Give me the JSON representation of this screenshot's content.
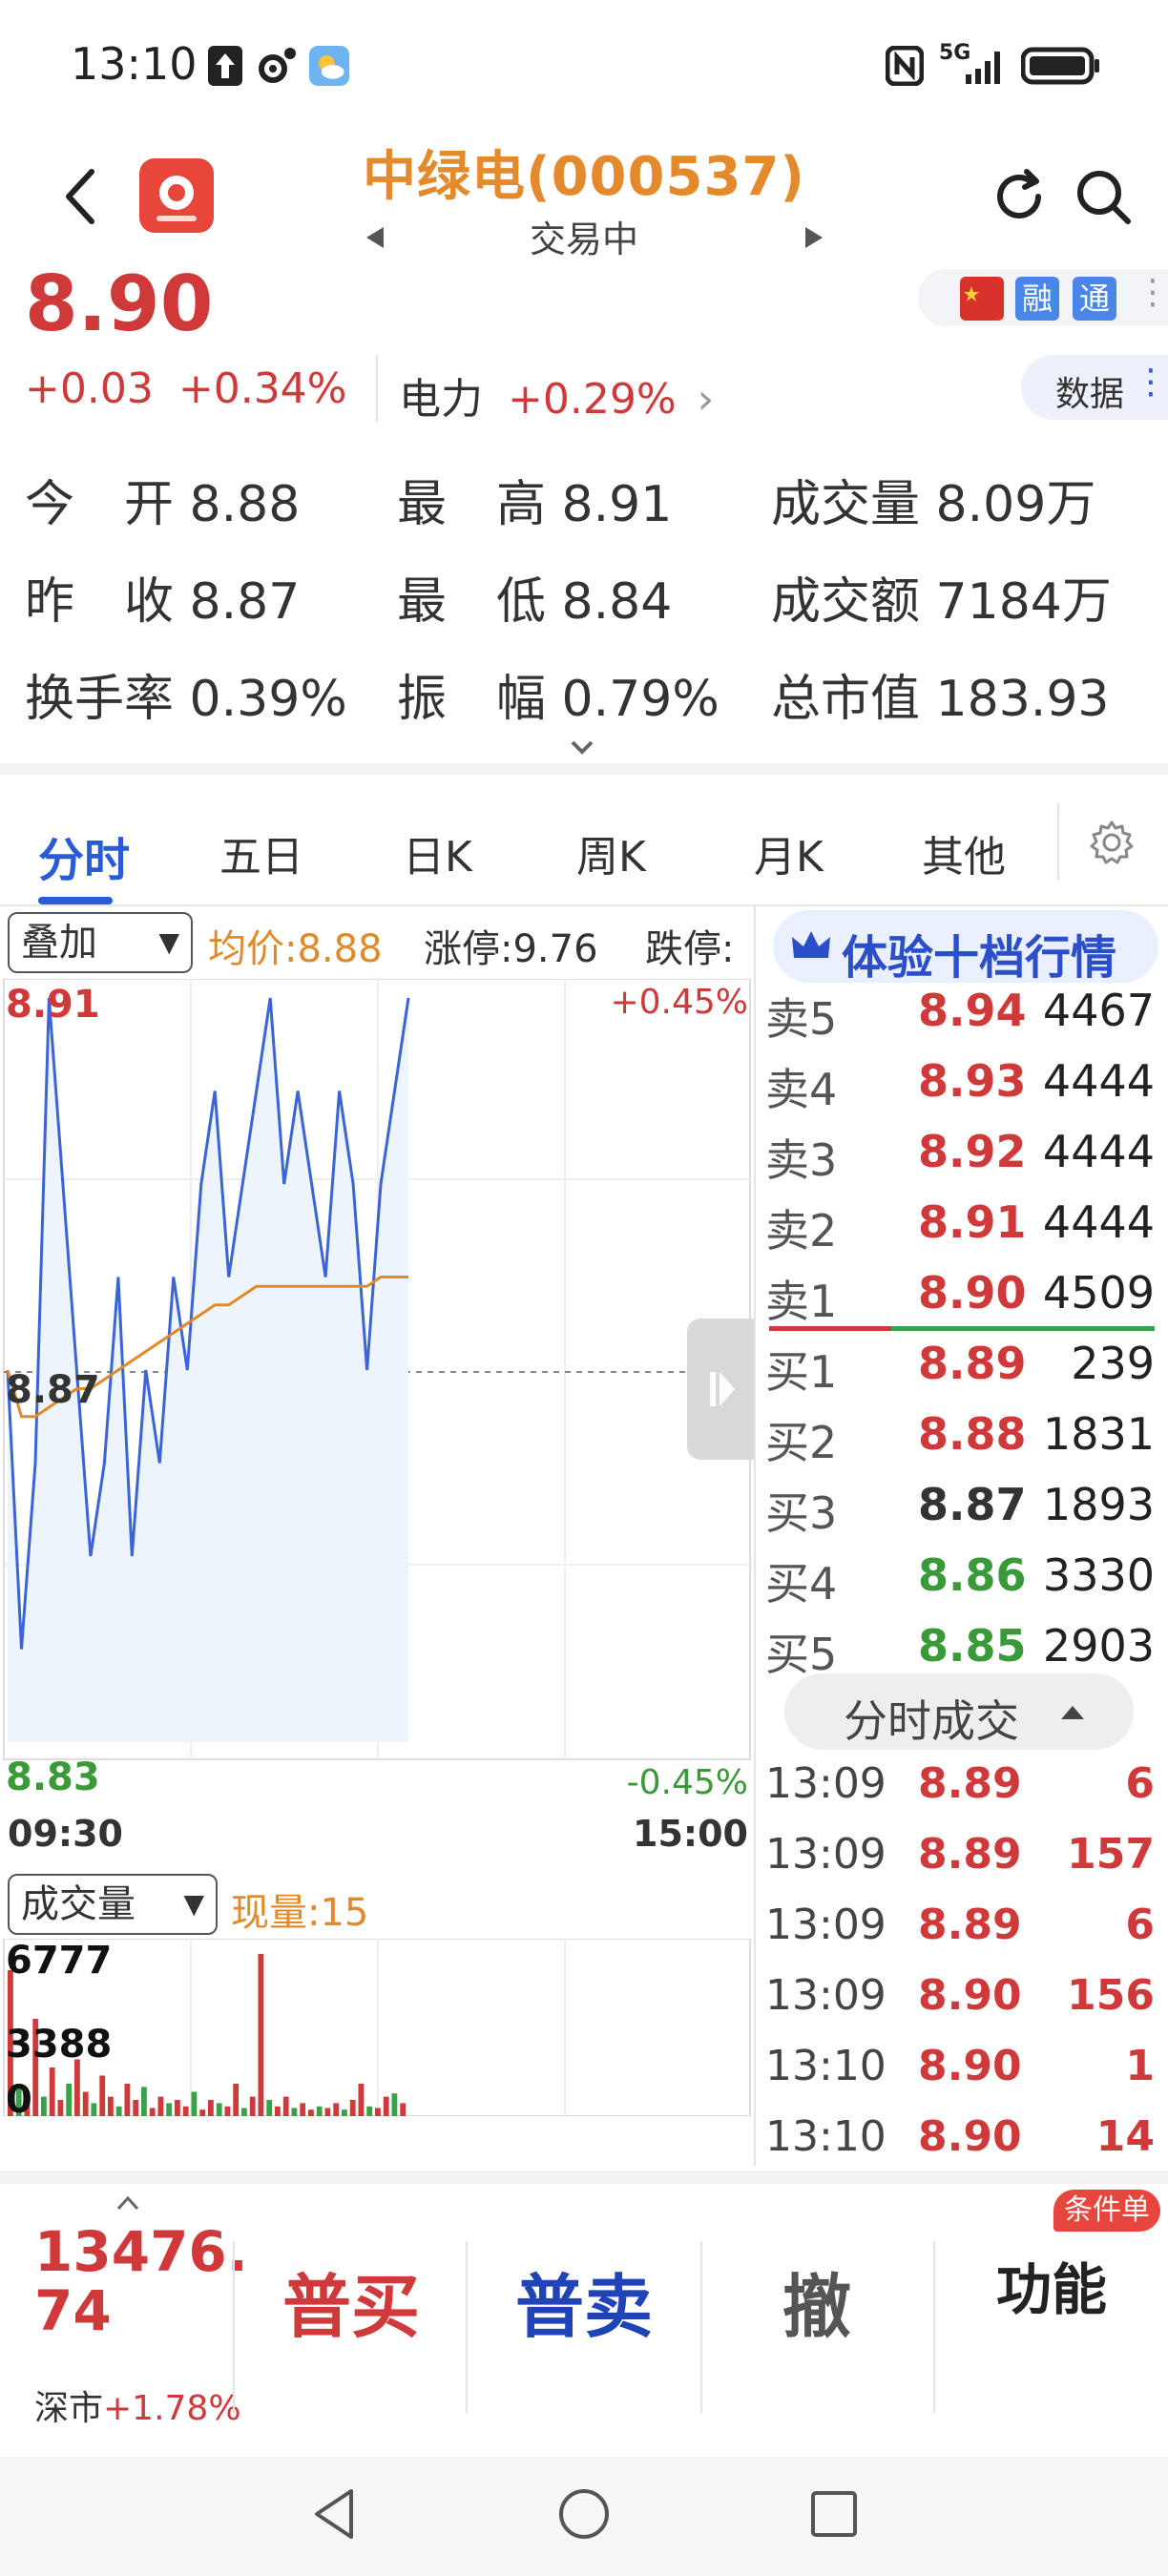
{
  "status_bar": {
    "time": "13:10",
    "network": "5G"
  },
  "header": {
    "stock_title": "中绿电(000537)",
    "trade_status": "交易中"
  },
  "price": {
    "last": "8.90",
    "change": "+0.03",
    "change_pct": "+0.34%",
    "sector_name": "电力",
    "sector_change": "+0.29%"
  },
  "tags": {
    "rong": "融",
    "tong": "通",
    "data_button": "数据"
  },
  "stats": [
    {
      "label": "今　开",
      "value": "8.88"
    },
    {
      "label": "最　高",
      "value": "8.91"
    },
    {
      "label": "成交量",
      "value": "8.09万"
    },
    {
      "label": "昨　收",
      "value": "8.87"
    },
    {
      "label": "最　低",
      "value": "8.84"
    },
    {
      "label": "成交额",
      "value": "7184万"
    },
    {
      "label": "换手率",
      "value": "0.39%"
    },
    {
      "label": "振　幅",
      "value": "0.79%"
    },
    {
      "label": "总市值",
      "value": "183.93"
    }
  ],
  "tabs": [
    "分时",
    "五日",
    "日K",
    "周K",
    "月K",
    "其他"
  ],
  "chart_controls": {
    "overlay_select": "叠加",
    "avg_price": "均价:8.88",
    "limit_up": "涨停:9.76",
    "limit_down": "跌停:",
    "volume_select": "成交量",
    "current_volume": "现量:15"
  },
  "chart_data": {
    "type": "line",
    "y_max_label": "8.91",
    "y_mid_label": "8.87",
    "y_min_label": "8.83",
    "pct_max_label": "+0.45%",
    "pct_min_label": "-0.45%",
    "x_start_label": "09:30",
    "x_end_label": "15:00",
    "ylim": [
      8.83,
      8.91
    ],
    "prev_close": 8.87,
    "series": [
      {
        "values": [
          8.87,
          8.84,
          8.86,
          8.91,
          8.89,
          8.87,
          8.85,
          8.86,
          8.88,
          8.85,
          8.87,
          8.86,
          8.88,
          8.87,
          8.89,
          8.9,
          8.88,
          8.89,
          8.9,
          8.91,
          8.89,
          8.9,
          8.89,
          8.88,
          8.9,
          8.89,
          8.87,
          8.89,
          8.9,
          8.91
        ]
      },
      {
        "values": [
          8.87,
          8.865,
          8.865,
          8.866,
          8.867,
          8.868,
          8.868,
          8.869,
          8.87,
          8.871,
          8.872,
          8.873,
          8.874,
          8.875,
          8.876,
          8.877,
          8.877,
          8.878,
          8.879,
          8.879,
          8.879,
          8.879,
          8.879,
          8.879,
          8.879,
          8.879,
          8.879,
          8.88,
          8.88,
          8.88
        ]
      }
    ],
    "volume_labels": [
      "6777",
      "3388",
      "0"
    ],
    "volume_max": 6777
  },
  "order_book": {
    "upgrade_label": "体验十档行情",
    "asks": [
      {
        "label": "卖5",
        "price": "8.94",
        "volume": "4467"
      },
      {
        "label": "卖4",
        "price": "8.93",
        "volume": "4444"
      },
      {
        "label": "卖3",
        "price": "8.92",
        "volume": "4444"
      },
      {
        "label": "卖2",
        "price": "8.91",
        "volume": "4444"
      },
      {
        "label": "卖1",
        "price": "8.90",
        "volume": "4509"
      }
    ],
    "bids": [
      {
        "label": "买1",
        "price": "8.89",
        "volume": "239"
      },
      {
        "label": "买2",
        "price": "8.88",
        "volume": "1831"
      },
      {
        "label": "买3",
        "price": "8.87",
        "volume": "1893"
      },
      {
        "label": "买4",
        "price": "8.86",
        "volume": "3330"
      },
      {
        "label": "买5",
        "price": "8.85",
        "volume": "2903"
      }
    ],
    "trades_toggle": "分时成交",
    "trades": [
      {
        "time": "13:09",
        "price": "8.89",
        "volume": "6"
      },
      {
        "time": "13:09",
        "price": "8.89",
        "volume": "157"
      },
      {
        "time": "13:09",
        "price": "8.89",
        "volume": "6"
      },
      {
        "time": "13:09",
        "price": "8.90",
        "volume": "156"
      },
      {
        "time": "13:10",
        "price": "8.90",
        "volume": "1"
      },
      {
        "time": "13:10",
        "price": "8.90",
        "volume": "14"
      }
    ]
  },
  "action_bar": {
    "index_value_line1": "13476.",
    "index_value_line2": "74",
    "index_name": "深市",
    "index_change": "+1.78%",
    "buy": "普买",
    "sell": "普卖",
    "cancel": "撤",
    "functions": "功能",
    "condition_badge": "条件单"
  }
}
